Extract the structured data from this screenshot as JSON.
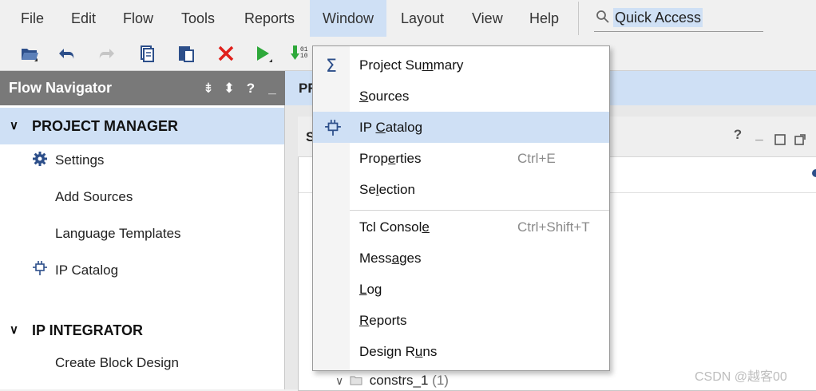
{
  "menubar": {
    "items": [
      {
        "label": "File"
      },
      {
        "label": "Edit"
      },
      {
        "label": "Flow"
      },
      {
        "label": "Tools"
      },
      {
        "label": "Reports"
      },
      {
        "label": "Window"
      },
      {
        "label": "Layout"
      },
      {
        "label": "View"
      },
      {
        "label": "Help"
      }
    ],
    "open_item": "Window"
  },
  "quick_access": {
    "text": "Quick Access",
    "icon": "search-icon"
  },
  "toolbar": {
    "buttons": [
      {
        "icon": "open-project-icon"
      },
      {
        "icon": "undo-icon"
      },
      {
        "icon": "redo-icon"
      },
      {
        "icon": "copy-icon"
      },
      {
        "icon": "paste-icon"
      },
      {
        "icon": "delete-icon"
      },
      {
        "icon": "run-icon"
      },
      {
        "icon": "bitstream-icon"
      }
    ]
  },
  "flow_navigator": {
    "title": "Flow Navigator",
    "header_icons": [
      "collapse-all-icon",
      "expand-icon",
      "help-icon",
      "minimize-icon"
    ],
    "sections": [
      {
        "label": "PROJECT MANAGER",
        "items": [
          {
            "label": "Settings",
            "icon": "gear-icon"
          },
          {
            "label": "Add Sources"
          },
          {
            "label": "Language Templates"
          },
          {
            "label": "IP Catalog",
            "icon": "ip-catalog-icon"
          }
        ]
      },
      {
        "label": "IP INTEGRATOR",
        "items": [
          {
            "label": "Create Block Design"
          }
        ]
      }
    ]
  },
  "main": {
    "header_partial": "PR",
    "sources_partial": "S",
    "panel_controls": [
      "help-icon",
      "minimize-icon",
      "restore-icon",
      "maximize-icon"
    ],
    "tree_row": {
      "label": "constrs_1",
      "count": "(1)"
    }
  },
  "window_menu": {
    "items": [
      {
        "label": "Project Summary",
        "icon": "sigma-icon"
      },
      {
        "label": "Sources"
      },
      {
        "label": "IP Catalog",
        "icon": "ip-catalog-icon",
        "highlighted": true
      },
      {
        "label": "Properties",
        "shortcut": "Ctrl+E"
      },
      {
        "label": "Selection"
      },
      {
        "label": "Tcl Console",
        "shortcut": "Ctrl+Shift+T"
      },
      {
        "label": "Messages"
      },
      {
        "label": "Log"
      },
      {
        "label": "Reports"
      },
      {
        "label": "Design Runs"
      }
    ]
  },
  "watermark": "CSDN @越客00",
  "colors": {
    "highlight": "#cfe0f5",
    "nav_header": "#797979",
    "accent_blue": "#2d4f8a",
    "delete_red": "#e0201b",
    "run_green": "#2ea83a"
  }
}
